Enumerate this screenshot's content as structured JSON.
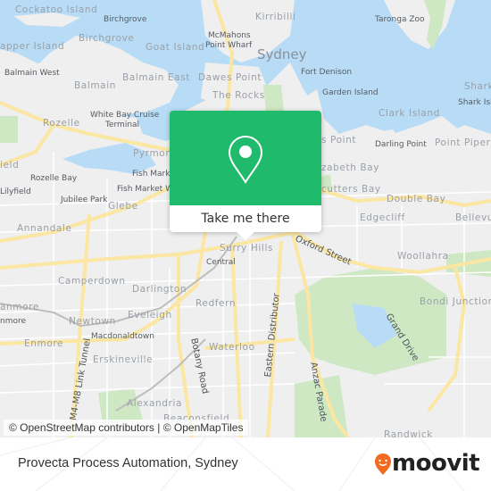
{
  "map": {
    "labels": {
      "cockatoo_island": "Cockatoo Island",
      "birchgrove_small": "Birchgrove",
      "birchgrove": "Birchgrove",
      "snapper_island": "apper Island",
      "balmain_west": "Balmain West",
      "balmain": "Balmain",
      "balmain_east": "Balmain East",
      "rozelle": "Rozelle",
      "white_bay": "White Bay Cruise",
      "white_bay_2": "Terminal",
      "kirribilli": "Kirribilli",
      "mcmahons": "McMahons",
      "mcmahons_2": "Point Wharf",
      "goat_island": "Goat Island",
      "sydney": "Sydney",
      "dawes_point": "Dawes Point",
      "the_rocks": "The Rocks",
      "fort_denison": "Fort Denison",
      "garden_island": "Garden Island",
      "taronga_zoo": "Taronga Zoo",
      "clark_island": "Clark Island",
      "shark": "Shark",
      "shark_island": "Shark Isla",
      "darling_point": "Darling Point",
      "point_piper": "Point Piper",
      "potts_point": "s Point",
      "elizabeth_bay": "zabeth Bay",
      "rushcutters_bay": "cutters Bay",
      "double_bay": "Double Bay",
      "edgecliff": "Edgecliff",
      "bellevue": "Bellevu",
      "oxford_street": "Oxford Street",
      "woollahra": "Woollahra",
      "bondi_junction": "Bondi Junction",
      "pyrmont": "Pyrmont",
      "fish_market": "Fish Market",
      "fish_market_w": "Fish Market W",
      "rozelle_bay": "Rozelle Bay",
      "lilyfield": "Lilyfield",
      "field": "ield",
      "jubilee_park": "Jubilee Park",
      "glebe": "Glebe",
      "annandale": "Annandale",
      "surry_hills": "Surry Hills",
      "central": "Central",
      "camperdown": "Camperdown",
      "darlington": "Darlington",
      "stanmore": "anmore",
      "stanmore_station": "nmore",
      "newtown": "Newtown",
      "eveleigh": "Eveleigh",
      "macdonaldtown": "Macdonaldtown",
      "enmore": "Enmore",
      "redfern": "Redfern",
      "erskineville": "Erskineville",
      "waterloo": "Waterloo",
      "m4m8": "M4-M8 Link Tunnel",
      "botany_road": "Botany Road",
      "eastern_distributor": "Eastern Distributor",
      "anzac_parade": "Anzac Parade",
      "grand_drive": "Grand Drive",
      "alexandria": "Alexandria",
      "beaconsfield": "Beaconsfield",
      "randwick": "Randwick"
    },
    "attribution": "© OpenStreetMap contributors | © OpenMapTiles"
  },
  "popup": {
    "icon": "location-pin-icon",
    "button_label": "Take me there",
    "color": "#1fba6b"
  },
  "footer": {
    "title": "Provecta Process Automation, Sydney",
    "brand": "moovit",
    "brand_color": "#f26b21"
  }
}
